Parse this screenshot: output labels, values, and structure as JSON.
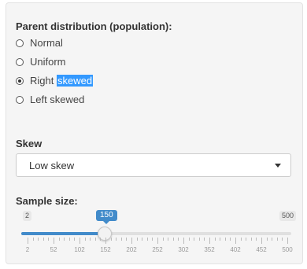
{
  "distribution": {
    "title": "Parent distribution (population):",
    "options": [
      {
        "label": "Normal",
        "checked": false
      },
      {
        "label": "Uniform",
        "checked": false
      },
      {
        "label_prefix": "Right ",
        "label_highlight": "skewed",
        "checked": true
      },
      {
        "label": "Left skewed",
        "checked": false
      }
    ]
  },
  "skew": {
    "label": "Skew",
    "selected": "Low skew"
  },
  "sample_size": {
    "label": "Sample size:",
    "min": 2,
    "max": 500,
    "value": 150,
    "min_label": "2",
    "max_label": "500",
    "value_label": "150",
    "major_ticks": [
      "2",
      "52",
      "102",
      "152",
      "202",
      "252",
      "302",
      "352",
      "402",
      "452",
      "500"
    ]
  },
  "colors": {
    "accent": "#428bca",
    "highlight": "#3399ff"
  }
}
